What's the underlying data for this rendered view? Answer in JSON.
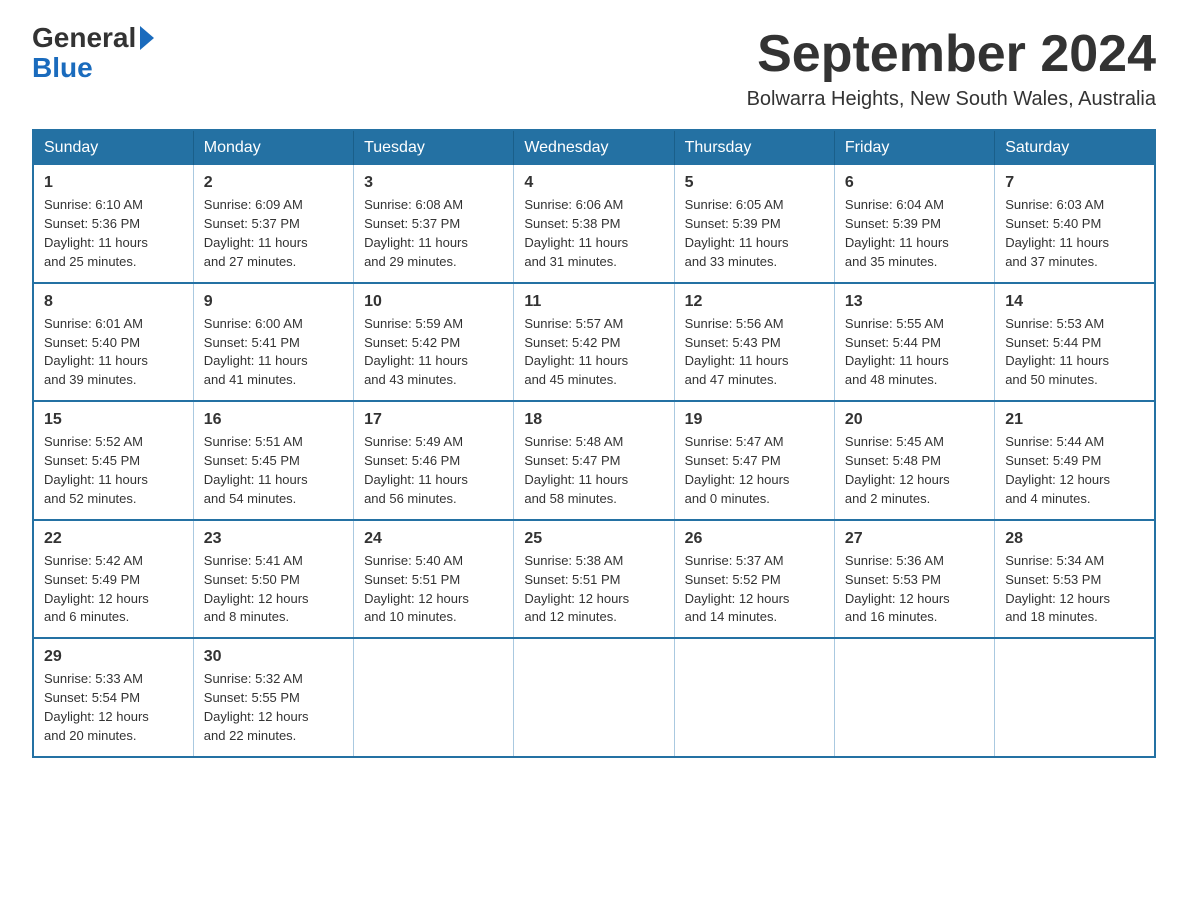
{
  "logo": {
    "general_text": "General",
    "blue_text": "Blue"
  },
  "title": "September 2024",
  "location": "Bolwarra Heights, New South Wales, Australia",
  "days_of_week": [
    "Sunday",
    "Monday",
    "Tuesday",
    "Wednesday",
    "Thursday",
    "Friday",
    "Saturday"
  ],
  "weeks": [
    [
      {
        "day": "1",
        "sunrise": "6:10 AM",
        "sunset": "5:36 PM",
        "daylight": "11 hours and 25 minutes."
      },
      {
        "day": "2",
        "sunrise": "6:09 AM",
        "sunset": "5:37 PM",
        "daylight": "11 hours and 27 minutes."
      },
      {
        "day": "3",
        "sunrise": "6:08 AM",
        "sunset": "5:37 PM",
        "daylight": "11 hours and 29 minutes."
      },
      {
        "day": "4",
        "sunrise": "6:06 AM",
        "sunset": "5:38 PM",
        "daylight": "11 hours and 31 minutes."
      },
      {
        "day": "5",
        "sunrise": "6:05 AM",
        "sunset": "5:39 PM",
        "daylight": "11 hours and 33 minutes."
      },
      {
        "day": "6",
        "sunrise": "6:04 AM",
        "sunset": "5:39 PM",
        "daylight": "11 hours and 35 minutes."
      },
      {
        "day": "7",
        "sunrise": "6:03 AM",
        "sunset": "5:40 PM",
        "daylight": "11 hours and 37 minutes."
      }
    ],
    [
      {
        "day": "8",
        "sunrise": "6:01 AM",
        "sunset": "5:40 PM",
        "daylight": "11 hours and 39 minutes."
      },
      {
        "day": "9",
        "sunrise": "6:00 AM",
        "sunset": "5:41 PM",
        "daylight": "11 hours and 41 minutes."
      },
      {
        "day": "10",
        "sunrise": "5:59 AM",
        "sunset": "5:42 PM",
        "daylight": "11 hours and 43 minutes."
      },
      {
        "day": "11",
        "sunrise": "5:57 AM",
        "sunset": "5:42 PM",
        "daylight": "11 hours and 45 minutes."
      },
      {
        "day": "12",
        "sunrise": "5:56 AM",
        "sunset": "5:43 PM",
        "daylight": "11 hours and 47 minutes."
      },
      {
        "day": "13",
        "sunrise": "5:55 AM",
        "sunset": "5:44 PM",
        "daylight": "11 hours and 48 minutes."
      },
      {
        "day": "14",
        "sunrise": "5:53 AM",
        "sunset": "5:44 PM",
        "daylight": "11 hours and 50 minutes."
      }
    ],
    [
      {
        "day": "15",
        "sunrise": "5:52 AM",
        "sunset": "5:45 PM",
        "daylight": "11 hours and 52 minutes."
      },
      {
        "day": "16",
        "sunrise": "5:51 AM",
        "sunset": "5:45 PM",
        "daylight": "11 hours and 54 minutes."
      },
      {
        "day": "17",
        "sunrise": "5:49 AM",
        "sunset": "5:46 PM",
        "daylight": "11 hours and 56 minutes."
      },
      {
        "day": "18",
        "sunrise": "5:48 AM",
        "sunset": "5:47 PM",
        "daylight": "11 hours and 58 minutes."
      },
      {
        "day": "19",
        "sunrise": "5:47 AM",
        "sunset": "5:47 PM",
        "daylight": "12 hours and 0 minutes."
      },
      {
        "day": "20",
        "sunrise": "5:45 AM",
        "sunset": "5:48 PM",
        "daylight": "12 hours and 2 minutes."
      },
      {
        "day": "21",
        "sunrise": "5:44 AM",
        "sunset": "5:49 PM",
        "daylight": "12 hours and 4 minutes."
      }
    ],
    [
      {
        "day": "22",
        "sunrise": "5:42 AM",
        "sunset": "5:49 PM",
        "daylight": "12 hours and 6 minutes."
      },
      {
        "day": "23",
        "sunrise": "5:41 AM",
        "sunset": "5:50 PM",
        "daylight": "12 hours and 8 minutes."
      },
      {
        "day": "24",
        "sunrise": "5:40 AM",
        "sunset": "5:51 PM",
        "daylight": "12 hours and 10 minutes."
      },
      {
        "day": "25",
        "sunrise": "5:38 AM",
        "sunset": "5:51 PM",
        "daylight": "12 hours and 12 minutes."
      },
      {
        "day": "26",
        "sunrise": "5:37 AM",
        "sunset": "5:52 PM",
        "daylight": "12 hours and 14 minutes."
      },
      {
        "day": "27",
        "sunrise": "5:36 AM",
        "sunset": "5:53 PM",
        "daylight": "12 hours and 16 minutes."
      },
      {
        "day": "28",
        "sunrise": "5:34 AM",
        "sunset": "5:53 PM",
        "daylight": "12 hours and 18 minutes."
      }
    ],
    [
      {
        "day": "29",
        "sunrise": "5:33 AM",
        "sunset": "5:54 PM",
        "daylight": "12 hours and 20 minutes."
      },
      {
        "day": "30",
        "sunrise": "5:32 AM",
        "sunset": "5:55 PM",
        "daylight": "12 hours and 22 minutes."
      },
      null,
      null,
      null,
      null,
      null
    ]
  ],
  "labels": {
    "sunrise": "Sunrise:",
    "sunset": "Sunset:",
    "daylight": "Daylight:"
  }
}
